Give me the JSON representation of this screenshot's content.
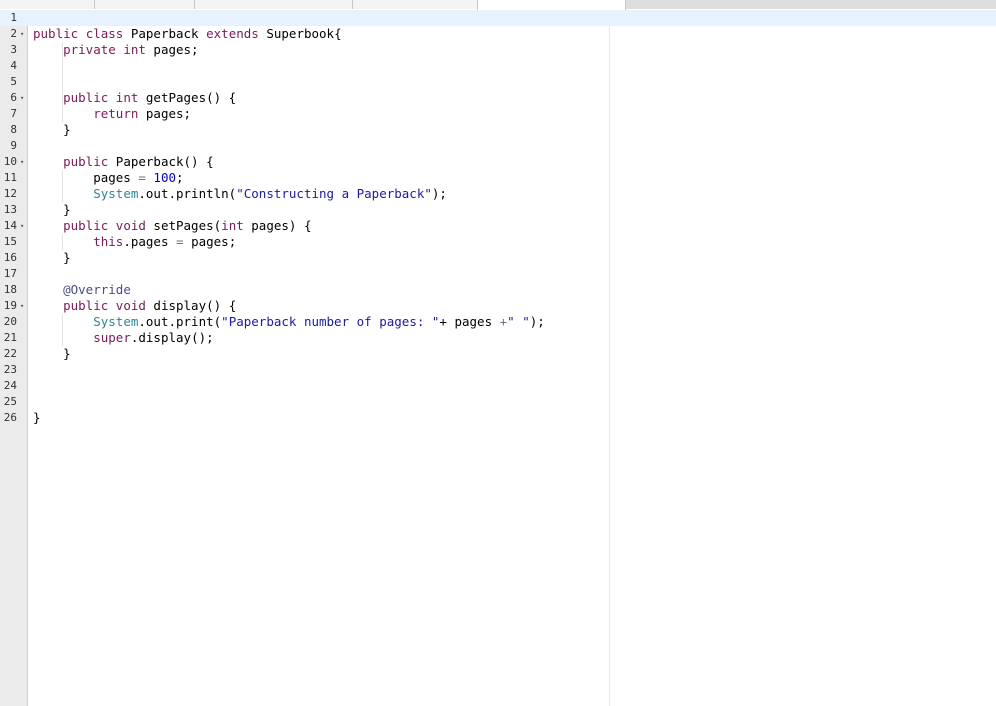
{
  "editor": {
    "lines": [
      {
        "num": "1",
        "fold": "",
        "tokens": []
      },
      {
        "num": "2",
        "fold": "▾",
        "tokens": [
          {
            "t": "public",
            "c": "k"
          },
          {
            "t": " "
          },
          {
            "t": "class",
            "c": "k"
          },
          {
            "t": " Paperback "
          },
          {
            "t": "extends",
            "c": "k"
          },
          {
            "t": " Superbook{"
          }
        ]
      },
      {
        "num": "3",
        "fold": "",
        "tokens": [
          {
            "t": "    "
          },
          {
            "t": "private",
            "c": "k"
          },
          {
            "t": " "
          },
          {
            "t": "int",
            "c": "t"
          },
          {
            "t": " pages;"
          }
        ]
      },
      {
        "num": "4",
        "fold": "",
        "tokens": []
      },
      {
        "num": "5",
        "fold": "",
        "tokens": []
      },
      {
        "num": "6",
        "fold": "▾",
        "tokens": [
          {
            "t": "    "
          },
          {
            "t": "public",
            "c": "k"
          },
          {
            "t": " "
          },
          {
            "t": "int",
            "c": "t"
          },
          {
            "t": " getPages() {"
          }
        ]
      },
      {
        "num": "7",
        "fold": "",
        "tokens": [
          {
            "t": "        "
          },
          {
            "t": "return",
            "c": "k"
          },
          {
            "t": " pages;"
          }
        ]
      },
      {
        "num": "8",
        "fold": "",
        "tokens": [
          {
            "t": "    }"
          }
        ]
      },
      {
        "num": "9",
        "fold": "",
        "tokens": []
      },
      {
        "num": "10",
        "fold": "▾",
        "tokens": [
          {
            "t": "    "
          },
          {
            "t": "public",
            "c": "k"
          },
          {
            "t": " Paperback() {"
          }
        ]
      },
      {
        "num": "11",
        "fold": "",
        "tokens": [
          {
            "t": "        pages "
          },
          {
            "t": "=",
            "c": "o"
          },
          {
            "t": " "
          },
          {
            "t": "100",
            "c": "n"
          },
          {
            "t": ";"
          }
        ]
      },
      {
        "num": "12",
        "fold": "",
        "tokens": [
          {
            "t": "        "
          },
          {
            "t": "System",
            "c": "sv"
          },
          {
            "t": ".out.println("
          },
          {
            "t": "\"Constructing a Paperback\"",
            "c": "s"
          },
          {
            "t": ");"
          }
        ]
      },
      {
        "num": "13",
        "fold": "",
        "tokens": [
          {
            "t": "    }"
          }
        ]
      },
      {
        "num": "14",
        "fold": "▾",
        "tokens": [
          {
            "t": "    "
          },
          {
            "t": "public",
            "c": "k"
          },
          {
            "t": " "
          },
          {
            "t": "void",
            "c": "t"
          },
          {
            "t": " setPages("
          },
          {
            "t": "int",
            "c": "t"
          },
          {
            "t": " pages) {"
          }
        ]
      },
      {
        "num": "15",
        "fold": "",
        "tokens": [
          {
            "t": "        "
          },
          {
            "t": "this",
            "c": "k"
          },
          {
            "t": ".pages "
          },
          {
            "t": "=",
            "c": "o"
          },
          {
            "t": " pages;"
          }
        ]
      },
      {
        "num": "16",
        "fold": "",
        "tokens": [
          {
            "t": "    }"
          }
        ]
      },
      {
        "num": "17",
        "fold": "",
        "tokens": []
      },
      {
        "num": "18",
        "fold": "",
        "tokens": [
          {
            "t": "    "
          },
          {
            "t": "@Override",
            "c": "a"
          }
        ]
      },
      {
        "num": "19",
        "fold": "▾",
        "tokens": [
          {
            "t": "    "
          },
          {
            "t": "public",
            "c": "k"
          },
          {
            "t": " "
          },
          {
            "t": "void",
            "c": "t"
          },
          {
            "t": " display() {"
          }
        ]
      },
      {
        "num": "20",
        "fold": "",
        "tokens": [
          {
            "t": "        "
          },
          {
            "t": "System",
            "c": "sv"
          },
          {
            "t": ".out.print("
          },
          {
            "t": "\"Paperback number of pages: \"",
            "c": "s"
          },
          {
            "t": "+ pages "
          },
          {
            "t": "+",
            "c": "o"
          },
          {
            "t": "\" \"",
            "c": "s"
          },
          {
            "t": ");"
          }
        ]
      },
      {
        "num": "21",
        "fold": "",
        "tokens": [
          {
            "t": "        "
          },
          {
            "t": "super",
            "c": "k"
          },
          {
            "t": ".display();"
          }
        ]
      },
      {
        "num": "22",
        "fold": "",
        "tokens": [
          {
            "t": "    }"
          }
        ]
      },
      {
        "num": "23",
        "fold": "",
        "tokens": []
      },
      {
        "num": "24",
        "fold": "",
        "tokens": []
      },
      {
        "num": "25",
        "fold": "",
        "tokens": []
      },
      {
        "num": "26",
        "fold": "",
        "tokens": [
          {
            "t": "}"
          }
        ]
      }
    ]
  }
}
